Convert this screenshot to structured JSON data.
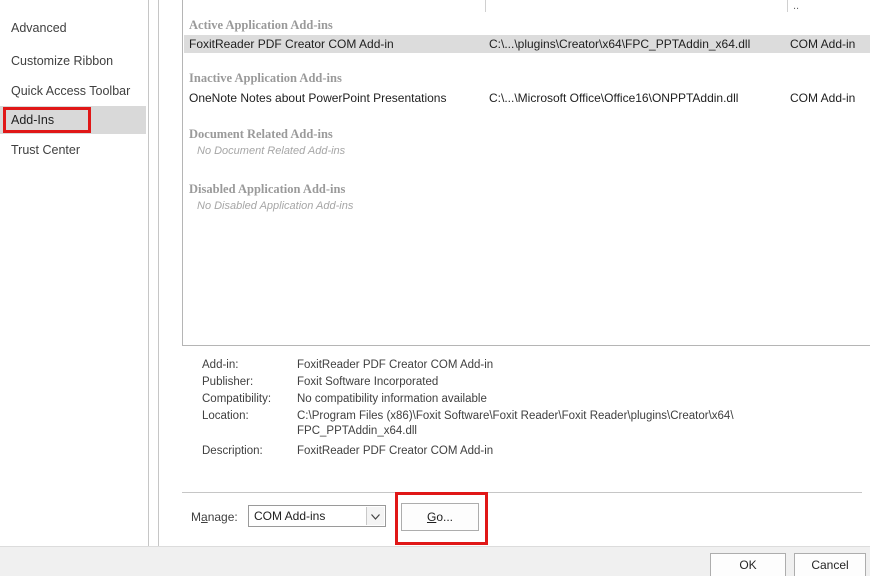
{
  "nav": {
    "items": [
      {
        "label": "Advanced"
      },
      {
        "label": "Customize Ribbon"
      },
      {
        "label": "Quick Access Toolbar"
      },
      {
        "label": "Add-Ins"
      },
      {
        "label": "Trust Center"
      }
    ]
  },
  "addins": {
    "header_stub": "..",
    "groups": {
      "active": {
        "title": "Active Application Add-ins",
        "rows": [
          {
            "name": "FoxitReader PDF Creator COM Add-in",
            "location": "C:\\...\\plugins\\Creator\\x64\\FPC_PPTAddin_x64.dll",
            "type": "COM Add-in"
          }
        ]
      },
      "inactive": {
        "title": "Inactive Application Add-ins",
        "rows": [
          {
            "name": "OneNote Notes about PowerPoint Presentations",
            "location": "C:\\...\\Microsoft Office\\Office16\\ONPPTAddin.dll",
            "type": "COM Add-in"
          }
        ]
      },
      "document": {
        "title": "Document Related Add-ins",
        "empty": "No Document Related Add-ins"
      },
      "disabled": {
        "title": "Disabled Application Add-ins",
        "empty": "No Disabled Application Add-ins"
      }
    }
  },
  "details": {
    "addin": {
      "label": "Add-in:",
      "value": "FoxitReader PDF Creator COM Add-in"
    },
    "publisher": {
      "label": "Publisher:",
      "value": "Foxit Software Incorporated"
    },
    "compatibility": {
      "label": "Compatibility:",
      "value": "No compatibility information available"
    },
    "location": {
      "label": "Location:",
      "value_line1": "C:\\Program Files (x86)\\Foxit Software\\Foxit Reader\\Foxit Reader\\plugins\\Creator\\x64\\",
      "value_line2": "FPC_PPTAddin_x64.dll"
    },
    "description": {
      "label": "Description:",
      "value": "FoxitReader PDF Creator COM Add-in"
    }
  },
  "manage": {
    "label_pre": "M",
    "label_accel": "a",
    "label_post": "nage:",
    "selected": "COM Add-ins",
    "dropdown_icon": "chevron-down-icon",
    "go_accel": "G",
    "go_rest": "o..."
  },
  "footer": {
    "ok": "OK",
    "cancel": "Cancel"
  },
  "colors": {
    "highlight_box": "#e01717",
    "selected_nav": "#d9d9d9",
    "selected_row": "#dcdcdc"
  }
}
